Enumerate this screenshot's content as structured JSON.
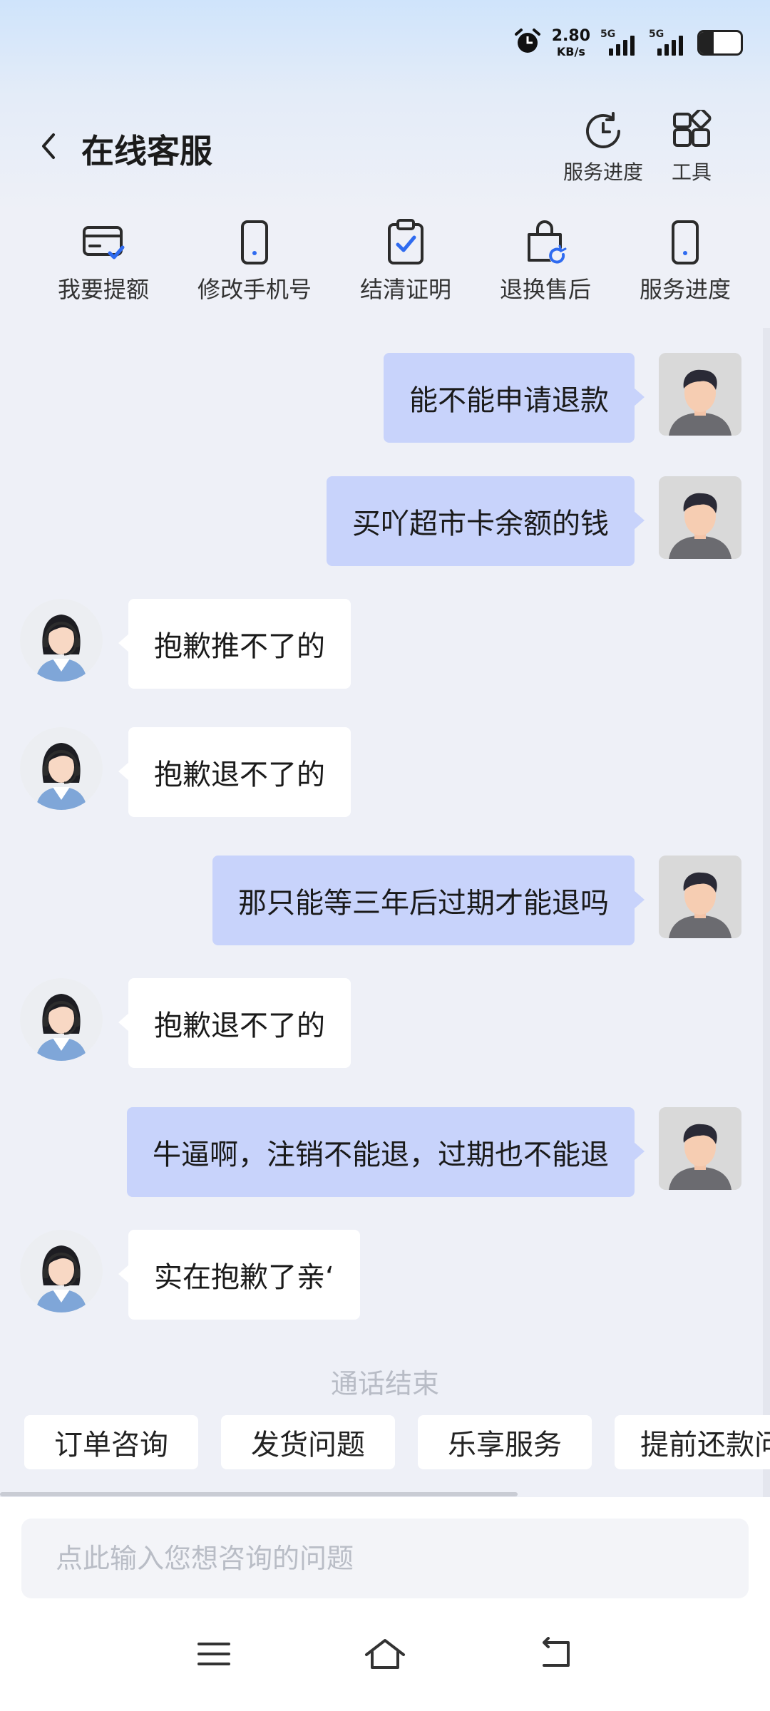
{
  "status_bar": {
    "net_speed_value": "2.80",
    "net_speed_unit": "KB/s",
    "signal_1": "5G",
    "signal_2": "5G",
    "battery_level": 0.35
  },
  "header": {
    "title": "在线客服",
    "service_progress_label": "服务进度",
    "tools_label": "工具"
  },
  "shortcuts": [
    {
      "label": "我要提额",
      "icon": "card-check-icon"
    },
    {
      "label": "修改手机号",
      "icon": "phone-icon"
    },
    {
      "label": "结清证明",
      "icon": "clipboard-check-icon"
    },
    {
      "label": "退换售后",
      "icon": "bag-refresh-icon"
    },
    {
      "label": "服务进度",
      "icon": "phone-icon"
    }
  ],
  "messages": [
    {
      "from": "user",
      "text": "能不能申请退款"
    },
    {
      "from": "user",
      "text": "买吖超市卡余额的钱"
    },
    {
      "from": "agent",
      "text": "抱歉推不了的"
    },
    {
      "from": "agent",
      "text": "抱歉退不了的"
    },
    {
      "from": "user",
      "text": "那只能等三年后过期才能退吗"
    },
    {
      "from": "agent",
      "text": "抱歉退不了的"
    },
    {
      "from": "user",
      "text": "牛逼啊，注销不能退，过期也不能退"
    },
    {
      "from": "agent",
      "text": "实在抱歉了亲‘"
    }
  ],
  "end_note": "通话结束",
  "quick_chips": [
    "订单咨询",
    "发货问题",
    "乐享服务",
    "提前还款问题"
  ],
  "input": {
    "placeholder": "点此输入您想咨询的问题",
    "value": ""
  },
  "colors": {
    "user_bubble": "#c8d3fb",
    "agent_bubble": "#ffffff",
    "accent_blue": "#2f6bf0",
    "background": "#eef0f7"
  }
}
